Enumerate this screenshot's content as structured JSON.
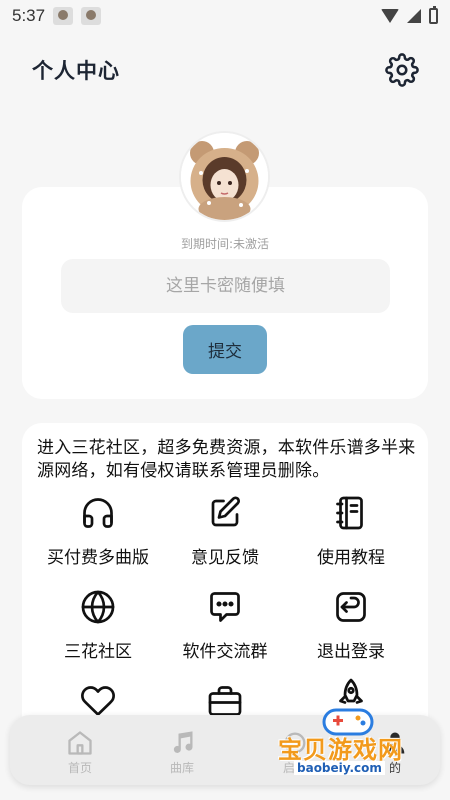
{
  "status_bar": {
    "time": "5:37"
  },
  "header": {
    "title": "个人中心",
    "settings_icon": "gear-icon"
  },
  "profile": {
    "avatar_icon": "avatar-girl-bear-hood",
    "expire_text": "到期时间:未激活",
    "code_placeholder": "这里卡密随便填",
    "code_value": "",
    "submit_label": "提交"
  },
  "notice": "进入三花社区，超多免费资源，本软件乐谱多半来源网络，如有侵权请联系管理员删除。",
  "menu": [
    {
      "label": "买付费多曲版",
      "icon": "headphones-icon"
    },
    {
      "label": "意见反馈",
      "icon": "edit-icon"
    },
    {
      "label": "使用教程",
      "icon": "notebook-icon"
    },
    {
      "label": "三花社区",
      "icon": "globe-icon"
    },
    {
      "label": "软件交流群",
      "icon": "chat-icon"
    },
    {
      "label": "退出登录",
      "icon": "logout-icon"
    },
    {
      "label": "",
      "icon": "heart-icon"
    },
    {
      "label": "",
      "icon": "briefcase-icon"
    },
    {
      "label": "",
      "icon": "rocket-icon"
    }
  ],
  "tabbar": [
    {
      "label": "首页",
      "icon": "home-icon"
    },
    {
      "label": "曲库",
      "icon": "music-icon"
    },
    {
      "label": "启动",
      "icon": "launch-icon"
    },
    {
      "label": "的",
      "icon": "user-icon"
    }
  ],
  "watermark": {
    "text": "宝贝游戏网",
    "url": "baobeiy.com"
  },
  "colors": {
    "accent": "#6ba7c9",
    "background": "#f6f6f6",
    "card": "#ffffff",
    "watermark": "#f29a1c"
  }
}
